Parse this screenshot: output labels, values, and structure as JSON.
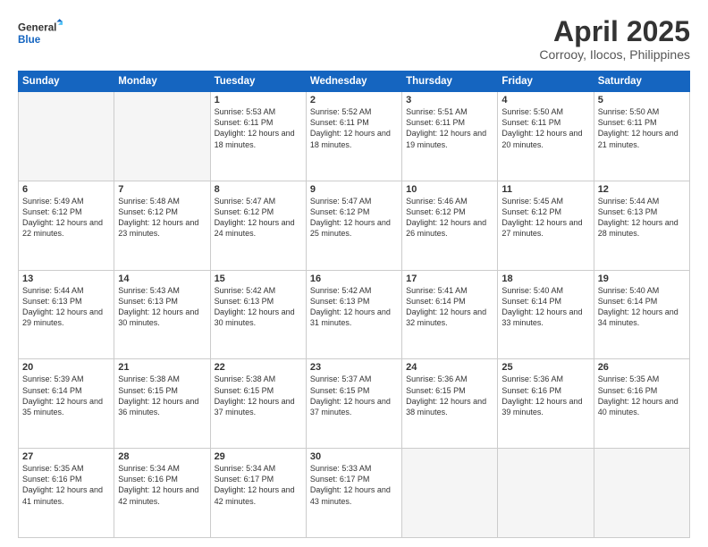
{
  "header": {
    "logo_line1": "General",
    "logo_line2": "Blue",
    "month": "April 2025",
    "location": "Corrooy, Ilocos, Philippines"
  },
  "days_of_week": [
    "Sunday",
    "Monday",
    "Tuesday",
    "Wednesday",
    "Thursday",
    "Friday",
    "Saturday"
  ],
  "weeks": [
    [
      {
        "day": "",
        "info": ""
      },
      {
        "day": "",
        "info": ""
      },
      {
        "day": "1",
        "info": "Sunrise: 5:53 AM\nSunset: 6:11 PM\nDaylight: 12 hours and 18 minutes."
      },
      {
        "day": "2",
        "info": "Sunrise: 5:52 AM\nSunset: 6:11 PM\nDaylight: 12 hours and 18 minutes."
      },
      {
        "day": "3",
        "info": "Sunrise: 5:51 AM\nSunset: 6:11 PM\nDaylight: 12 hours and 19 minutes."
      },
      {
        "day": "4",
        "info": "Sunrise: 5:50 AM\nSunset: 6:11 PM\nDaylight: 12 hours and 20 minutes."
      },
      {
        "day": "5",
        "info": "Sunrise: 5:50 AM\nSunset: 6:11 PM\nDaylight: 12 hours and 21 minutes."
      }
    ],
    [
      {
        "day": "6",
        "info": "Sunrise: 5:49 AM\nSunset: 6:12 PM\nDaylight: 12 hours and 22 minutes."
      },
      {
        "day": "7",
        "info": "Sunrise: 5:48 AM\nSunset: 6:12 PM\nDaylight: 12 hours and 23 minutes."
      },
      {
        "day": "8",
        "info": "Sunrise: 5:47 AM\nSunset: 6:12 PM\nDaylight: 12 hours and 24 minutes."
      },
      {
        "day": "9",
        "info": "Sunrise: 5:47 AM\nSunset: 6:12 PM\nDaylight: 12 hours and 25 minutes."
      },
      {
        "day": "10",
        "info": "Sunrise: 5:46 AM\nSunset: 6:12 PM\nDaylight: 12 hours and 26 minutes."
      },
      {
        "day": "11",
        "info": "Sunrise: 5:45 AM\nSunset: 6:12 PM\nDaylight: 12 hours and 27 minutes."
      },
      {
        "day": "12",
        "info": "Sunrise: 5:44 AM\nSunset: 6:13 PM\nDaylight: 12 hours and 28 minutes."
      }
    ],
    [
      {
        "day": "13",
        "info": "Sunrise: 5:44 AM\nSunset: 6:13 PM\nDaylight: 12 hours and 29 minutes."
      },
      {
        "day": "14",
        "info": "Sunrise: 5:43 AM\nSunset: 6:13 PM\nDaylight: 12 hours and 30 minutes."
      },
      {
        "day": "15",
        "info": "Sunrise: 5:42 AM\nSunset: 6:13 PM\nDaylight: 12 hours and 30 minutes."
      },
      {
        "day": "16",
        "info": "Sunrise: 5:42 AM\nSunset: 6:13 PM\nDaylight: 12 hours and 31 minutes."
      },
      {
        "day": "17",
        "info": "Sunrise: 5:41 AM\nSunset: 6:14 PM\nDaylight: 12 hours and 32 minutes."
      },
      {
        "day": "18",
        "info": "Sunrise: 5:40 AM\nSunset: 6:14 PM\nDaylight: 12 hours and 33 minutes."
      },
      {
        "day": "19",
        "info": "Sunrise: 5:40 AM\nSunset: 6:14 PM\nDaylight: 12 hours and 34 minutes."
      }
    ],
    [
      {
        "day": "20",
        "info": "Sunrise: 5:39 AM\nSunset: 6:14 PM\nDaylight: 12 hours and 35 minutes."
      },
      {
        "day": "21",
        "info": "Sunrise: 5:38 AM\nSunset: 6:15 PM\nDaylight: 12 hours and 36 minutes."
      },
      {
        "day": "22",
        "info": "Sunrise: 5:38 AM\nSunset: 6:15 PM\nDaylight: 12 hours and 37 minutes."
      },
      {
        "day": "23",
        "info": "Sunrise: 5:37 AM\nSunset: 6:15 PM\nDaylight: 12 hours and 37 minutes."
      },
      {
        "day": "24",
        "info": "Sunrise: 5:36 AM\nSunset: 6:15 PM\nDaylight: 12 hours and 38 minutes."
      },
      {
        "day": "25",
        "info": "Sunrise: 5:36 AM\nSunset: 6:16 PM\nDaylight: 12 hours and 39 minutes."
      },
      {
        "day": "26",
        "info": "Sunrise: 5:35 AM\nSunset: 6:16 PM\nDaylight: 12 hours and 40 minutes."
      }
    ],
    [
      {
        "day": "27",
        "info": "Sunrise: 5:35 AM\nSunset: 6:16 PM\nDaylight: 12 hours and 41 minutes."
      },
      {
        "day": "28",
        "info": "Sunrise: 5:34 AM\nSunset: 6:16 PM\nDaylight: 12 hours and 42 minutes."
      },
      {
        "day": "29",
        "info": "Sunrise: 5:34 AM\nSunset: 6:17 PM\nDaylight: 12 hours and 42 minutes."
      },
      {
        "day": "30",
        "info": "Sunrise: 5:33 AM\nSunset: 6:17 PM\nDaylight: 12 hours and 43 minutes."
      },
      {
        "day": "",
        "info": ""
      },
      {
        "day": "",
        "info": ""
      },
      {
        "day": "",
        "info": ""
      }
    ]
  ]
}
